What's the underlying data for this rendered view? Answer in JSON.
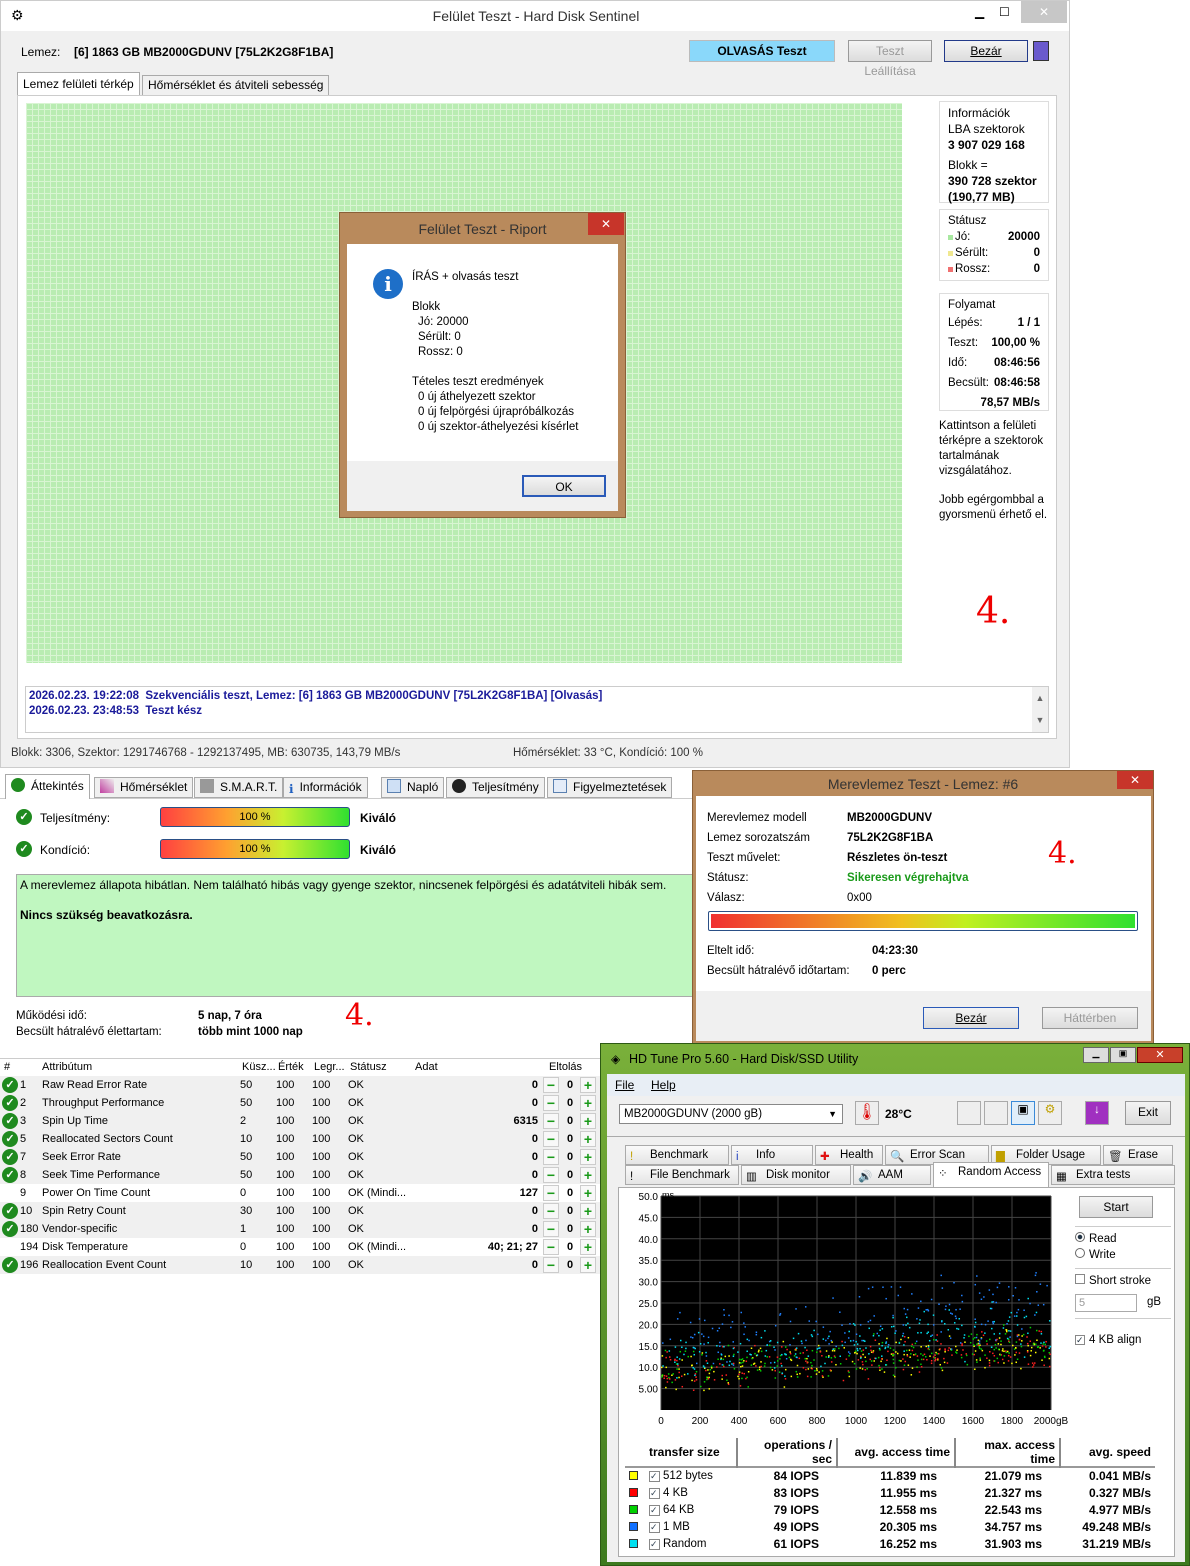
{
  "surface": {
    "title": "Felület Teszt - Hard Disk Sentinel",
    "disk_label": "Lemez:",
    "disk_value": "[6] 1863 GB  MB2000GDUNV [75L2K2G8F1BA]",
    "mode_button": "OLVASÁS Teszt",
    "stop_button": "Teszt Leállítása",
    "close_button": "Bezár",
    "tabs": [
      "Lemez felületi térkép",
      "Hőmérséklet és átviteli sebesség"
    ],
    "info": {
      "header": "Információk",
      "lba_label": "LBA szektorok",
      "lba_value": "3 907 029 168",
      "block_label": "Blokk =",
      "block_value": "390 728 szektor",
      "block_size": "(190,77 MB)"
    },
    "status": {
      "header": "Státusz",
      "good_label": "Jó:",
      "good": "20000",
      "damaged_label": "Sérült:",
      "damaged": "0",
      "bad_label": "Rossz:",
      "bad": "0",
      "colors": {
        "good": "#a8e8a0",
        "damaged": "#f0e890",
        "bad": "#f07070"
      }
    },
    "progress": {
      "header": "Folyamat",
      "step_label": "Lépés:",
      "step": "1 / 1",
      "test_label": "Teszt:",
      "test": "100,00 %",
      "time_label": "Idő:",
      "time": "08:46:56",
      "est_label": "Becsült:",
      "est": "08:46:58",
      "speed": "78,57 MB/s"
    },
    "hint1": "Kattintson a felületi térképre a szektorok tartalmának vizsgálatához.",
    "hint2": "Jobb egérgombbal a gyorsmenü érhető el.",
    "annotation": "4.",
    "log": [
      {
        "time": "2026.02.23.  19:22:08",
        "text": "Szekvenciális teszt, Lemez: [6] 1863 GB  MB2000GDUNV [75L2K2G8F1BA] [Olvasás]"
      },
      {
        "time": "2026.02.23.  23:48:53",
        "text": "Teszt kész"
      }
    ],
    "statusbar": {
      "left": "Blokk: 3306, Szektor: 1291746768 - 1292137495, MB: 630735, 143,79 MB/s",
      "right": "Hőmérséklet: 33  °C, Kondíció: 100 %"
    }
  },
  "report": {
    "title": "Felület Teszt - Riport",
    "line1": "ÍRÁS + olvasás teszt",
    "block": "Blokk",
    "good": "Jó: 20000",
    "damaged": "Sérült: 0",
    "bad": "Rossz: 0",
    "results": "Tételes teszt eredmények",
    "r1": "0 új áthelyezett szektor",
    "r2": "0 új felpörgési újrapróbálkozás",
    "r3": "0 új szektor-áthelyezési kísérlet",
    "ok": "OK"
  },
  "overview": {
    "tabs": [
      "Áttekintés",
      "Hőmérséklet",
      "S.M.A.R.T.",
      "Információk",
      "Napló",
      "Teljesítmény",
      "Figyelmeztetések"
    ],
    "perf_label": "Teljesítmény:",
    "perf_value": "100 %",
    "perf_rating": "Kiváló",
    "cond_label": "Kondíció:",
    "cond_value": "100 %",
    "cond_rating": "Kiváló",
    "message": "A merevlemez állapota hibátlan. Nem található hibás vagy gyenge szektor, nincsenek felpörgési és adatátviteli hibák sem.",
    "action": "Nincs szükség beavatkozásra.",
    "uptime_label": "Működési idő:",
    "uptime": "5 nap, 7 óra",
    "life_label": "Becsült hátralévő élettartam:",
    "life": "több mint 1000 nap",
    "annotation": "4."
  },
  "smart": {
    "headers": [
      "#",
      "Attribútum",
      "Küsz...",
      "Érték",
      "Legr...",
      "Státusz",
      "Adat",
      "Eltolás"
    ],
    "rows": [
      {
        "id": "1",
        "name": "Raw Read Error Rate",
        "thr": "50",
        "val": "100",
        "worst": "100",
        "status": "OK",
        "data": "0",
        "offset": "0",
        "ok": true
      },
      {
        "id": "2",
        "name": "Throughput Performance",
        "thr": "50",
        "val": "100",
        "worst": "100",
        "status": "OK",
        "data": "0",
        "offset": "0",
        "ok": true
      },
      {
        "id": "3",
        "name": "Spin Up Time",
        "thr": "2",
        "val": "100",
        "worst": "100",
        "status": "OK",
        "data": "6315",
        "offset": "0",
        "ok": true
      },
      {
        "id": "5",
        "name": "Reallocated Sectors Count",
        "thr": "10",
        "val": "100",
        "worst": "100",
        "status": "OK",
        "data": "0",
        "offset": "0",
        "ok": true
      },
      {
        "id": "7",
        "name": "Seek Error Rate",
        "thr": "50",
        "val": "100",
        "worst": "100",
        "status": "OK",
        "data": "0",
        "offset": "0",
        "ok": true
      },
      {
        "id": "8",
        "name": "Seek Time Performance",
        "thr": "50",
        "val": "100",
        "worst": "100",
        "status": "OK",
        "data": "0",
        "offset": "0",
        "ok": true
      },
      {
        "id": "9",
        "name": "Power On Time Count",
        "thr": "0",
        "val": "100",
        "worst": "100",
        "status": "OK (Mindi...",
        "data": "127",
        "offset": "0",
        "ok": false
      },
      {
        "id": "10",
        "name": "Spin Retry Count",
        "thr": "30",
        "val": "100",
        "worst": "100",
        "status": "OK",
        "data": "0",
        "offset": "0",
        "ok": true
      },
      {
        "id": "180",
        "name": "Vendor-specific",
        "thr": "1",
        "val": "100",
        "worst": "100",
        "status": "OK",
        "data": "0",
        "offset": "0",
        "ok": true
      },
      {
        "id": "194",
        "name": "Disk Temperature",
        "thr": "0",
        "val": "100",
        "worst": "100",
        "status": "OK (Mindi...",
        "data": "40; 21; 27",
        "offset": "0",
        "ok": false
      },
      {
        "id": "196",
        "name": "Reallocation Event Count",
        "thr": "10",
        "val": "100",
        "worst": "100",
        "status": "OK",
        "data": "0",
        "offset": "0",
        "ok": true
      }
    ]
  },
  "selftest": {
    "title": "Merevlemez Teszt - Lemez: #6",
    "model_label": "Merevlemez modell",
    "model": "MB2000GDUNV",
    "serial_label": "Lemez sorozatszám",
    "serial": "75L2K2G8F1BA",
    "op_label": "Teszt művelet:",
    "op": "Részletes ön-teszt",
    "status_label": "Státusz:",
    "status": "Sikeresen végrehajtva",
    "reply_label": "Válasz:",
    "reply": "0x00",
    "elapsed_label": "Eltelt idő:",
    "elapsed": "04:23:30",
    "remaining_label": "Becsült hátralévő időtartam:",
    "remaining": "0 perc",
    "progress": 100,
    "close": "Bezár",
    "background": "Háttérben",
    "annotation": "4."
  },
  "hdtune": {
    "title": "HD Tune Pro 5.60 - Hard Disk/SSD Utility",
    "menu": [
      "File",
      "Help"
    ],
    "drive": "MB2000GDUNV (2000 gB)",
    "temp": "28°C",
    "exit": "Exit",
    "tabs_row1": [
      "Benchmark",
      "Info",
      "Health",
      "Error Scan",
      "Folder Usage",
      "Erase"
    ],
    "tabs_row2": [
      "File Benchmark",
      "Disk monitor",
      "AAM",
      "Random Access",
      "Extra tests"
    ],
    "start": "Start",
    "read": "Read",
    "write": "Write",
    "short_stroke": "Short stroke",
    "stroke_value": "5",
    "stroke_unit": "gB",
    "align": "4 KB align",
    "y_unit": "ms",
    "y_ticks": [
      "50.0",
      "45.0",
      "40.0",
      "35.0",
      "30.0",
      "25.0",
      "20.0",
      "15.0",
      "10.0",
      "5.00"
    ],
    "x_ticks": [
      "0",
      "200",
      "400",
      "600",
      "800",
      "1000",
      "1200",
      "1400",
      "1600",
      "1800",
      "2000gB"
    ],
    "headers": [
      "transfer size",
      "operations / sec",
      "avg. access time",
      "max. access time",
      "avg. speed"
    ],
    "rows": [
      {
        "size": "512 bytes",
        "ops": "84 IOPS",
        "avg": "11.839 ms",
        "max": "21.079 ms",
        "speed": "0.041 MB/s",
        "color": "#ffff00"
      },
      {
        "size": "4 KB",
        "ops": "83 IOPS",
        "avg": "11.955 ms",
        "max": "21.327 ms",
        "speed": "0.327 MB/s",
        "color": "#ff0000"
      },
      {
        "size": "64 KB",
        "ops": "79 IOPS",
        "avg": "12.558 ms",
        "max": "22.543 ms",
        "speed": "4.977 MB/s",
        "color": "#00d000"
      },
      {
        "size": "1 MB",
        "ops": "49 IOPS",
        "avg": "20.305 ms",
        "max": "34.757 ms",
        "speed": "49.248 MB/s",
        "color": "#1070ff"
      },
      {
        "size": "Random",
        "ops": "61 IOPS",
        "avg": "16.252 ms",
        "max": "31.903 ms",
        "speed": "31.219 MB/s",
        "color": "#00e0f0"
      }
    ]
  }
}
